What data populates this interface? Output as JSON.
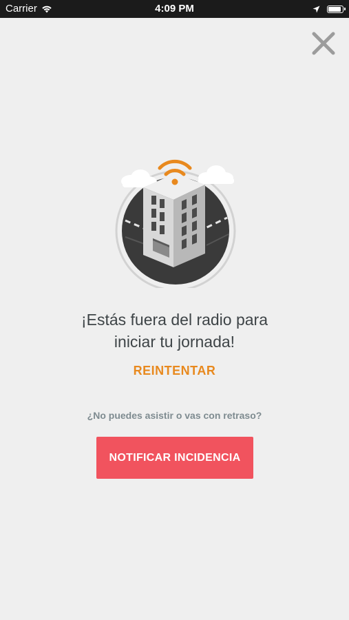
{
  "status_bar": {
    "carrier": "Carrier",
    "time": "4:09 PM",
    "battery_level": 1.0
  },
  "icons": {
    "close": "close-icon",
    "wifi": "wifi-icon",
    "location": "location-arrow-icon",
    "battery": "battery-icon",
    "illustration": "building-wifi-illustration"
  },
  "main": {
    "headline_line1": "¡Estás fuera del radio para",
    "headline_line2": "iniciar tu jornada!",
    "retry_label": "REINTENTAR",
    "question": "¿No puedes asistir o vas con retraso?",
    "notify_label": "NOTIFICAR INCIDENCIA"
  },
  "colors": {
    "accent": "#e8891e",
    "button": "#f1535e",
    "background": "#efefef",
    "text": "#3e4447"
  }
}
